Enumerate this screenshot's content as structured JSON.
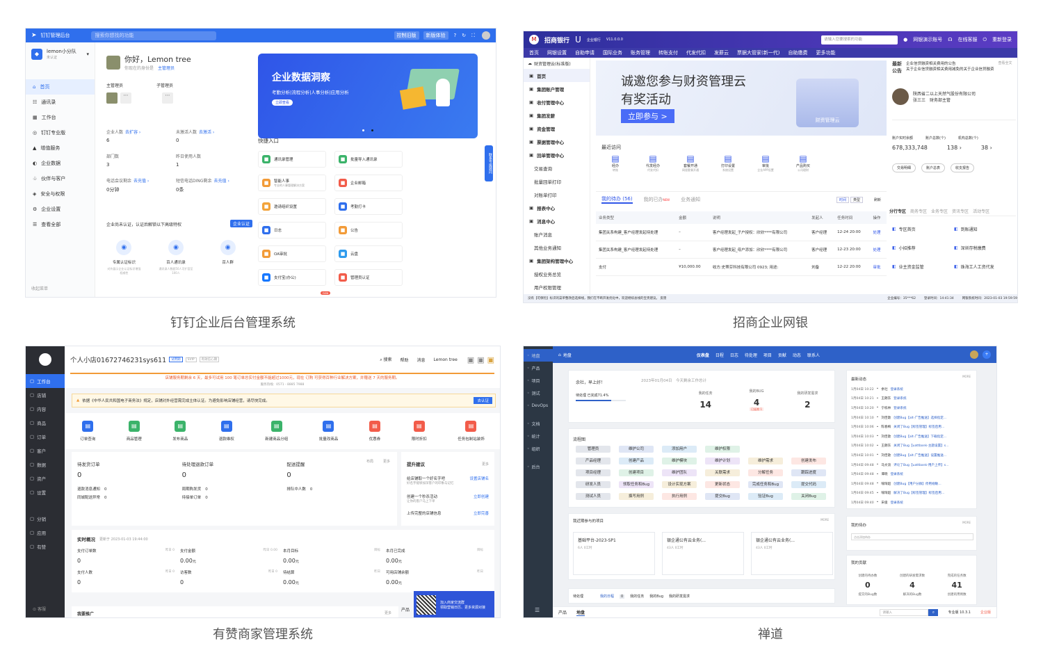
{
  "captions": {
    "dingtalk": "钉钉企业后台管理系统",
    "cmb": "招商企业网银",
    "youzan": "有赞商家管理系统",
    "zentao": "禅道"
  },
  "dingtalk": {
    "app_title": "钉钉管理后台",
    "search_placeholder": "搜索你想找的功能",
    "top_btn1": "控制旧版",
    "top_btn2": "新版体验",
    "org_name": "lemon小分队",
    "org_sub": "未认证",
    "menu": [
      "首页",
      "通讯录",
      "工作台",
      "钉钉专业版",
      "增值服务",
      "企业数据",
      "伙伴与客户",
      "安全与权限",
      "企业设置",
      "查看全部"
    ],
    "collapse": "收起菜单",
    "greeting": "你好，Lemon tree",
    "role_label": "你现在的身份是",
    "role": "主管理员",
    "main_admin": "主管理员",
    "sub_admin": "子管理员",
    "stats": [
      {
        "label": "企业人数",
        "link": "去扩容 ›",
        "value": "6"
      },
      {
        "label": "未激活人数",
        "link": "去激活 ›",
        "value": "0"
      },
      {
        "label": "部门数",
        "link": "",
        "value": "3"
      },
      {
        "label": "昨日使用人数",
        "link": "",
        "value": "1"
      },
      {
        "label": "电话会议剩余",
        "link": "去充值 ›",
        "value": "0分钟"
      },
      {
        "label": "短信电话DING剩余",
        "link": "去充值 ›",
        "value": "0条"
      }
    ],
    "cert_note": "企业尚未认证，认证后解锁以下高级特权",
    "cert_btn": "企业认证",
    "privileges": [
      {
        "name": "专属认证标识",
        "desc": "对外展示企业认证标识增强权威性"
      },
      {
        "name": "百人通讯录",
        "desc": "通讯录人数超50人可扩容至100人"
      },
      {
        "name": "百人群",
        "desc": ""
      }
    ],
    "banner_title": "企业数据洞察",
    "banner_sub": "考勤分析|流程分析|人事分析|应用分析",
    "banner_btn": "立即查看",
    "quick_title": "快捷入口",
    "quick": [
      {
        "name": "通讯录管理",
        "color": "#3bb36a"
      },
      {
        "name": "批量导入通讯录",
        "color": "#3bb36a"
      },
      {
        "name": "智能人事",
        "sub": "专业的人事管理解决方案",
        "color": "#f29b38"
      },
      {
        "name": "企业邮箱",
        "color": "#f25c4a"
      },
      {
        "name": "邀请组织设置",
        "color": "#f2a33a"
      },
      {
        "name": "考勤打卡",
        "color": "#2f6fed"
      },
      {
        "name": "日志",
        "color": "#2f6fed"
      },
      {
        "name": "公告",
        "color": "#f29b38"
      },
      {
        "name": "OA审批",
        "color": "#f29b38"
      },
      {
        "name": "云盘",
        "color": "#2f9bed"
      },
      {
        "name": "支付宝(办公)",
        "color": "#1677ff"
      },
      {
        "name": "管理员认证",
        "color": "#f25c4a"
      }
    ],
    "new_badge": "new",
    "float_tab": "联系专属顾问"
  },
  "cmb": {
    "brand": "招商银行",
    "ebank": "企业银行",
    "version": "V11.0.0.0",
    "search_placeholder": "请输入您要搜索的功能",
    "user": "网银演示账号",
    "service": "在线客服",
    "relogin": "重新登录",
    "nav": [
      "首页",
      "网银设置",
      "自助申请",
      "国际业务",
      "账务管理",
      "转账支付",
      "代发代扣",
      "发薪云",
      "票据大管家(新一代)",
      "自助缴费",
      "更多功能"
    ],
    "side_title": "财资管理云(标准版)",
    "side": [
      "首页",
      "集团账户管理",
      "收付管理中心",
      "集团发薪",
      "资金管理",
      "票据管理中心",
      "回单管理中心",
      "交易查询",
      "批量回单打印",
      "对账单打印",
      "报表中心",
      "消息中心",
      "账户消息",
      "其他业务通知",
      "集团架构管理中心",
      "授权业务总览",
      "用户权限管理"
    ],
    "banner_l1": "诚邀您参与财资管理云",
    "banner_l2": "有奖活动",
    "banner_btn": "立即参与 >",
    "banner_img_text": "财资管理云",
    "recent_title": "最近访问",
    "recent": [
      {
        "name": "经办",
        "sub": "转账"
      },
      {
        "name": "代发经办",
        "sub": "代发代扣"
      },
      {
        "name": "套餐开通",
        "sub": "网银套餐开通"
      },
      {
        "name": "打印设置",
        "sub": "系统设置"
      },
      {
        "name": "审批",
        "sub": "企业APP设置"
      },
      {
        "name": "产品购买",
        "sub": "公司理财"
      }
    ],
    "tabs": [
      "我的待办 (56)",
      "我的已办",
      "业务通知"
    ],
    "new_tag": "NEW",
    "time_btn": "时间",
    "type_btn": "类型",
    "refresh": "刷新",
    "table_head": [
      "业务类型",
      "金额",
      "说明",
      "发起人",
      "任务时间",
      "操作"
    ],
    "rows": [
      {
        "type": "集团关系构建_客户经理发起待处理",
        "amount": "–",
        "desc": "客户经理发起_子户授权：欣欣****有限公司",
        "from": "客户经理",
        "time": "12-24 20:00",
        "op": "处理"
      },
      {
        "type": "集团关系构建_客户经理发起待处理",
        "amount": "–",
        "desc": "客户经理发起_母户添加：欣欣****有限公司",
        "from": "客户经理",
        "time": "12-23 20:00",
        "op": "处理"
      },
      {
        "type": "支付",
        "amount": "¥10,000.00",
        "desc": "收方:史蒂芬科技有限公司 0923; 用途:",
        "from": "刘备",
        "time": "12-22 20:00",
        "op": "审批"
      }
    ],
    "notice_label": "最新公告",
    "notice": [
      "企业信贷融资相关费用的公告",
      "关于企业信贷融资相关费用减免的关于企业信贷融资"
    ],
    "notice_more": "查看全文",
    "company": "陕西省二以上天然气股份有限公司",
    "person": "张三三",
    "person_role": "财务部主管",
    "acct1_label": "账户实时余额",
    "acct1": "678,333,748",
    "acct2_label": "账户总数(个)",
    "acct2": "138 ›",
    "acct3_label": "机构总数(个)",
    "acct3": "38 ›",
    "acct_btns": [
      "交易明细",
      "账户总表",
      "收支报告"
    ],
    "zone_tabs": [
      "分行专区",
      "商务专区",
      "业务专区",
      "资讯专区",
      "活动专区"
    ],
    "zone": [
      "专区首页",
      "到账通知",
      "小招推荐",
      "深圳存税缴费",
      "业主资金监管",
      "珠海工人工资代发"
    ],
    "status": "没有【可保险】标识的菜单整改后选择线，我们在不断开发优化中，欢迎继续总线的宝贵建议。 反馈",
    "status_r1": "企业编号：35***62",
    "status_r2": "登录时间：14:41:34",
    "status_r3": "网银系统时间：2023-01-03 19:59:59"
  },
  "youzan": {
    "shop": "个人小店01672746231sys611",
    "tags": [
      "试用期",
      "SVIP",
      "有效信心期"
    ],
    "top": [
      "搜索",
      "帮助",
      "消息",
      "Lemon tree"
    ],
    "side": [
      "工作台",
      "店铺",
      "内容",
      "商品",
      "订单",
      "客户",
      "数据",
      "资产",
      "设置",
      "分销",
      "应用",
      "有赞"
    ],
    "side_bottom": "客服",
    "notice": "店铺服务期剩余 6 天，最多可试用 100 笔订单总实付金额不能超过1000元，现在 订购 可获得百种行业解决方案，并赠送 7 天的服务期。",
    "notice_sub": "服务热线：0571 - 8885 7988",
    "warn": "依据《中华人民共和国电子商务法》规定，店铺对外经营需完成主体认证。为避免影响店铺经营，请尽快完成。",
    "warn_btn": "去认证",
    "icons": [
      {
        "name": "订单查询",
        "color": "#2f6fed"
      },
      {
        "name": "商品管理",
        "color": "#3bb36a"
      },
      {
        "name": "发布商品",
        "color": "#3bb36a"
      },
      {
        "name": "退款维权",
        "color": "#2f6fed"
      },
      {
        "name": "新建商品分组",
        "color": "#3bb36a"
      },
      {
        "name": "批量改商品",
        "color": "#2f6fed"
      },
      {
        "name": "优惠券",
        "color": "#f25c4a"
      },
      {
        "name": "限时折扣",
        "color": "#f25c4a"
      },
      {
        "name": "任务包制站装饰",
        "color": "#f25c4a"
      }
    ],
    "todo": [
      {
        "title": "待发货订单",
        "value": "0",
        "l1": "退款消息通知",
        "v1": "0",
        "l2": "同城配送异常",
        "v2": "0"
      },
      {
        "title": "待处理退款订单",
        "value": "0",
        "l1": "周期购发货",
        "v1": "0",
        "l2": "待接单订单",
        "v2": "0"
      },
      {
        "title": "配送提醒",
        "value": "0",
        "l1": "排队中人数",
        "v1": "0"
      }
    ],
    "todo_more1": "布局",
    "todo_more2": "更多",
    "upgrade_title": "提升建议",
    "upgrade_more": "更多",
    "up1": "给店铺取一个好名字吧",
    "up1_link": "设置店铺名",
    "up1_sub": "好名字能够加深客户的印象与记忆",
    "up2": "创建一个秒杀活动",
    "up2_link": "立即创建",
    "up2_sub": "让你的客户马上下单",
    "up3": "上传完整的店铺信息",
    "up3_link": "立即完善",
    "realtime": "实时概况",
    "updated": "更新于 2023-01-03 19:44:00",
    "kpi": [
      {
        "label": "支付订单数",
        "value": "0",
        "cmp": "昨日 0"
      },
      {
        "label": "支付金额",
        "value": "0.00",
        "unit": "元",
        "cmp": "昨日 0.00"
      },
      {
        "label": "本月目标",
        "value": "0.00",
        "unit": "元",
        "cmp": "目标"
      },
      {
        "label": "本月已完成",
        "value": "0.00",
        "unit": "元",
        "cmp": "目标"
      },
      {
        "label": "支付人数",
        "value": "0",
        "cmp": "昨日 0"
      },
      {
        "label": "访客数",
        "value": "0",
        "cmp": "昨日 0"
      },
      {
        "label": "待结算",
        "value": "0.00",
        "unit": "元",
        "cmp": "昨日"
      },
      {
        "label": "可用店铺余额",
        "value": "0.00",
        "unit": "元",
        "cmp": "昨日"
      }
    ],
    "promo_title": "我要推广",
    "promo_more": "更多",
    "qr_text1": "加入商家交流群",
    "qr_text2": "领取营销日历、更多资源对接",
    "bottom_right": "产品"
  },
  "zentao": {
    "side": [
      "地盘",
      "产品",
      "项目",
      "测试",
      "DevOps",
      "文档",
      "统计",
      "组织",
      "后台"
    ],
    "crumb": "地盘",
    "tabs": [
      "仪表盘",
      "日程",
      "日志",
      "待处理",
      "项目",
      "贡献",
      "动态",
      "联系人"
    ],
    "greeting": "余社，早上好！",
    "date": "2023年01月04日",
    "today_summary": "今天剩余工作总计",
    "done_pct": "待处理 已完成71.4%",
    "counts": [
      {
        "label": "我的任务",
        "value": "14"
      },
      {
        "label": "我的BUG",
        "value": "4",
        "tag": "已延期 1"
      },
      {
        "label": "我的研发需求",
        "value": "2"
      }
    ],
    "flow_title": "流程图",
    "flow_rows": [
      [
        "管理员",
        "维护公司",
        "添加用户",
        "维护权限"
      ],
      [
        "产品经理",
        "创建产品",
        "维护模块",
        "维护计划",
        "维护需求",
        "创建发布"
      ],
      [
        "项目经理",
        "创建项目",
        "维护团队",
        "关联需求",
        "分解任务",
        "跟踪进度"
      ],
      [
        "研发人员",
        "领取任务和Bug",
        "设计实现方案",
        "更新状态",
        "完成任务和Bug",
        "提交代码"
      ],
      [
        "测试人员",
        "撰写用例",
        "执行用例",
        "提交Bug",
        "验证Bug",
        "关闭Bug"
      ]
    ],
    "proj_title": "我近期参与的项目",
    "more": "MORE",
    "projects": [
      {
        "name": "基础平台-2023-SP1",
        "meta": "6人  0工时"
      },
      {
        "name": "银企通公有云业务(...",
        "meta": "43人  0工时"
      },
      {
        "name": "银企通公有云业务(...",
        "meta": "43人  0工时"
      }
    ],
    "pending_title": "待处理",
    "pending_tabs": [
      "我的日程",
      "我的任务",
      "我的Bug",
      "我的研发需求"
    ],
    "pending_badge": "0",
    "dyn_title": "最新动态",
    "dyn": [
      {
        "t": "1月04日 10:22",
        "who": "余社",
        "act": "登录系统"
      },
      {
        "t": "1月04日 10:21",
        "who": "王朗东",
        "act": "登录系统"
      },
      {
        "t": "1月04日 10:20",
        "who": "宁栋林",
        "act": "登录系统"
      },
      {
        "t": "1月04日 10:10",
        "who": "刘佳歌",
        "act": "创建Bug【alt-广告推送】选择指定..."
      },
      {
        "t": "1月04日 10:06",
        "who": "陈春梅",
        "act": "关闭了Bug【标签管理】标签启用..."
      },
      {
        "t": "1月04日 10:03",
        "who": "刘佳歌",
        "act": "创建Bug【alt-广告推送】下载指定..."
      },
      {
        "t": "1月04日 10:02",
        "who": "王朗东",
        "act": "关闭了Bug【uattbank-主题设置】s..."
      },
      {
        "t": "1月04日 10:01",
        "who": "刘佳歌",
        "act": "创建Bug【alt-广告推送】设置推送..."
      },
      {
        "t": "1月04日 09:48",
        "who": "马文浪",
        "act": "评论了Bug【uattbank-用户上传】s..."
      },
      {
        "t": "1月04日 09:48",
        "who": "谭晓",
        "act": "登录系统"
      },
      {
        "t": "1月04日 09:48",
        "who": "喻琦超",
        "act": "创建Bug【用户分群】停用规敏..."
      },
      {
        "t": "1月04日 09:45",
        "who": "喻琦超",
        "act": "解决了Bug【标签管理】标签启用..."
      },
      {
        "t": "1月04日 09:40",
        "who": "宋俊",
        "act": "登录系统"
      }
    ],
    "mytodo_title": "我的待办",
    "mytodo_placeholder": "点击添加待办",
    "contrib_title": "我的贡献",
    "contrib": [
      {
        "label": "创建的待办数",
        "value": "0",
        "sub": "提交的Bug数"
      },
      {
        "label": "创建的研发需求数",
        "value": "4",
        "sub": "解决的Bug数"
      },
      {
        "label": "完成的任务数",
        "value": "41",
        "sub": "创建的用例数"
      }
    ],
    "bottom": [
      "产品",
      "地盘"
    ],
    "search_placeholder": "请输入",
    "version": "专业版 10.3.1",
    "enterprise": "企业版"
  }
}
